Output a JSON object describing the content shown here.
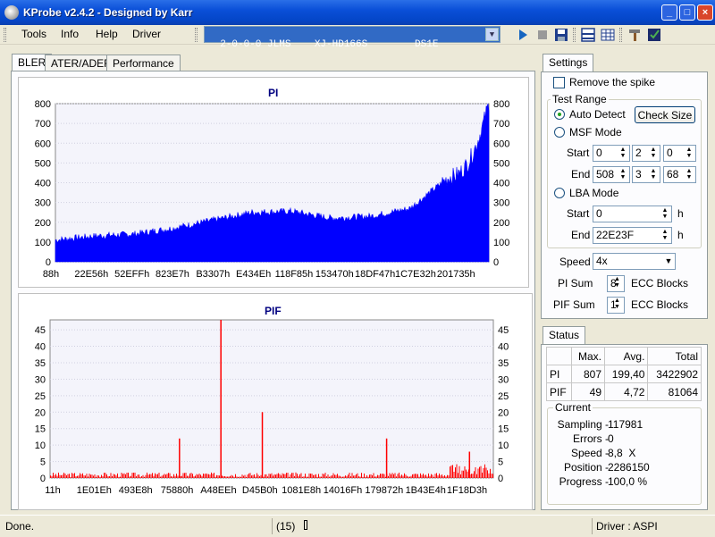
{
  "window": {
    "title": "KProbe v2.4.2 - Designed by Karr"
  },
  "menu": {
    "items": [
      "Tools",
      "Info",
      "Help",
      "Driver"
    ]
  },
  "drive": {
    "selected": "2-0-0-0 JLMS    XJ-HD166S        DS1E"
  },
  "tabs": [
    "BLER",
    "ATER/ADER",
    "Performance"
  ],
  "pi_chart": {
    "title": "PI",
    "yticks": [
      "800",
      "700",
      "600",
      "500",
      "400",
      "300",
      "200",
      "100",
      "0"
    ],
    "xticks": [
      "88h",
      "22E56h",
      "52EFFh",
      "823E7h",
      "B3307h",
      "E434Eh",
      "118F85h",
      "153470h",
      "18DF47h",
      "1C7E32h",
      "201735h"
    ]
  },
  "pif_chart": {
    "title": "PIF",
    "yticks": [
      "45",
      "40",
      "35",
      "30",
      "25",
      "20",
      "15",
      "10",
      "5",
      "0"
    ],
    "xticks": [
      "11h",
      "1E01Eh",
      "493E8h",
      "75880h",
      "A48EEh",
      "D45B0h",
      "1081E8h",
      "14016Fh",
      "179872h",
      "1B43E4h",
      "1F18D3h"
    ]
  },
  "chart_data": [
    {
      "type": "area",
      "title": "PI",
      "ylim": [
        0,
        800
      ],
      "x": [
        "88h",
        "22E56h",
        "52EFFh",
        "823E7h",
        "B3307h",
        "E434Eh",
        "118F85h",
        "153470h",
        "18DF47h",
        "1C7E32h",
        "201735h"
      ],
      "values": [
        110,
        130,
        140,
        170,
        210,
        250,
        255,
        220,
        230,
        270,
        430
      ],
      "end_value": 807,
      "color": "#0000FF"
    },
    {
      "type": "bar",
      "title": "PIF",
      "ylim": [
        0,
        48
      ],
      "x": [
        "11h",
        "1E01Eh",
        "493E8h",
        "75880h",
        "A48EEh",
        "D45B0h",
        "1081E8h",
        "14016Fh",
        "179872h",
        "1B43E4h",
        "1F18D3h"
      ],
      "baseline": 1,
      "spikes": [
        {
          "x": "75880h",
          "value": 12
        },
        {
          "x": "A48EEh",
          "value": 49
        },
        {
          "x": "D45B0h",
          "value": 20
        },
        {
          "x": "179872h",
          "value": 12
        },
        {
          "x": "1F18D3h",
          "value": 8
        }
      ],
      "color": "#FF0000"
    }
  ],
  "settings": {
    "tab": "Settings",
    "remove_spike": "Remove the spike",
    "test_range": "Test Range",
    "auto_detect": "Auto Detect",
    "check_size": "Check Size",
    "msf_mode": "MSF Mode",
    "start_label": "Start",
    "end_label": "End",
    "msf_start": [
      "0",
      "2",
      "0"
    ],
    "msf_end": [
      "508",
      "3",
      "68"
    ],
    "lba_mode": "LBA Mode",
    "lba_start": "0",
    "lba_end": "22E23F",
    "h_unit": "h",
    "speed_label": "Speed",
    "speed_value": "4x",
    "pi_sum_label": "PI Sum",
    "pi_sum_value": "8",
    "pif_sum_label": "PIF Sum",
    "pif_sum_value": "1",
    "ecc_blocks": "ECC Blocks"
  },
  "status": {
    "tab": "Status",
    "headers": [
      "",
      "Max.",
      "Avg.",
      "Total"
    ],
    "rows": [
      [
        "PI",
        "807",
        "199,40",
        "3422902"
      ],
      [
        "PIF",
        "49",
        "4,72",
        "81064"
      ]
    ],
    "current_label": "Current",
    "fields": [
      {
        "label": "Sampling -",
        "value": "117981"
      },
      {
        "label": "Errors -",
        "value": "0"
      },
      {
        "label": "Speed -",
        "value": "8,8  X"
      },
      {
        "label": "Position -",
        "value": "2286150"
      },
      {
        "label": "Progress -",
        "value": "100,0 %"
      }
    ]
  },
  "statusbar": {
    "left": "Done.",
    "middle": "(15)",
    "right": "Driver : ASPI"
  }
}
